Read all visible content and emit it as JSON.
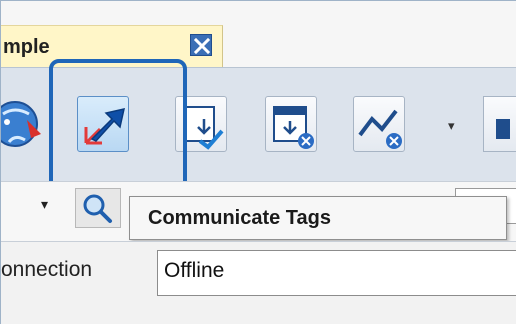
{
  "tab": {
    "label": "mple"
  },
  "toolbar": {
    "buttons": [
      {
        "id": "network",
        "icon": "network-globe-icon"
      },
      {
        "id": "communicate",
        "icon": "communicate-tags-icon",
        "active": true
      },
      {
        "id": "download",
        "icon": "download-check-icon"
      },
      {
        "id": "upload",
        "icon": "window-download-icon"
      },
      {
        "id": "trend",
        "icon": "trend-icon"
      },
      {
        "id": "partial",
        "icon": "toolbar-partial-icon"
      }
    ]
  },
  "tooltip": {
    "text": "Communicate Tags"
  },
  "connection": {
    "label": "onnection",
    "value": "Offline"
  },
  "colors": {
    "accent": "#1f66b8",
    "tab_bg": "#fff6c8",
    "toolbar_bg": "#dce3ec"
  }
}
